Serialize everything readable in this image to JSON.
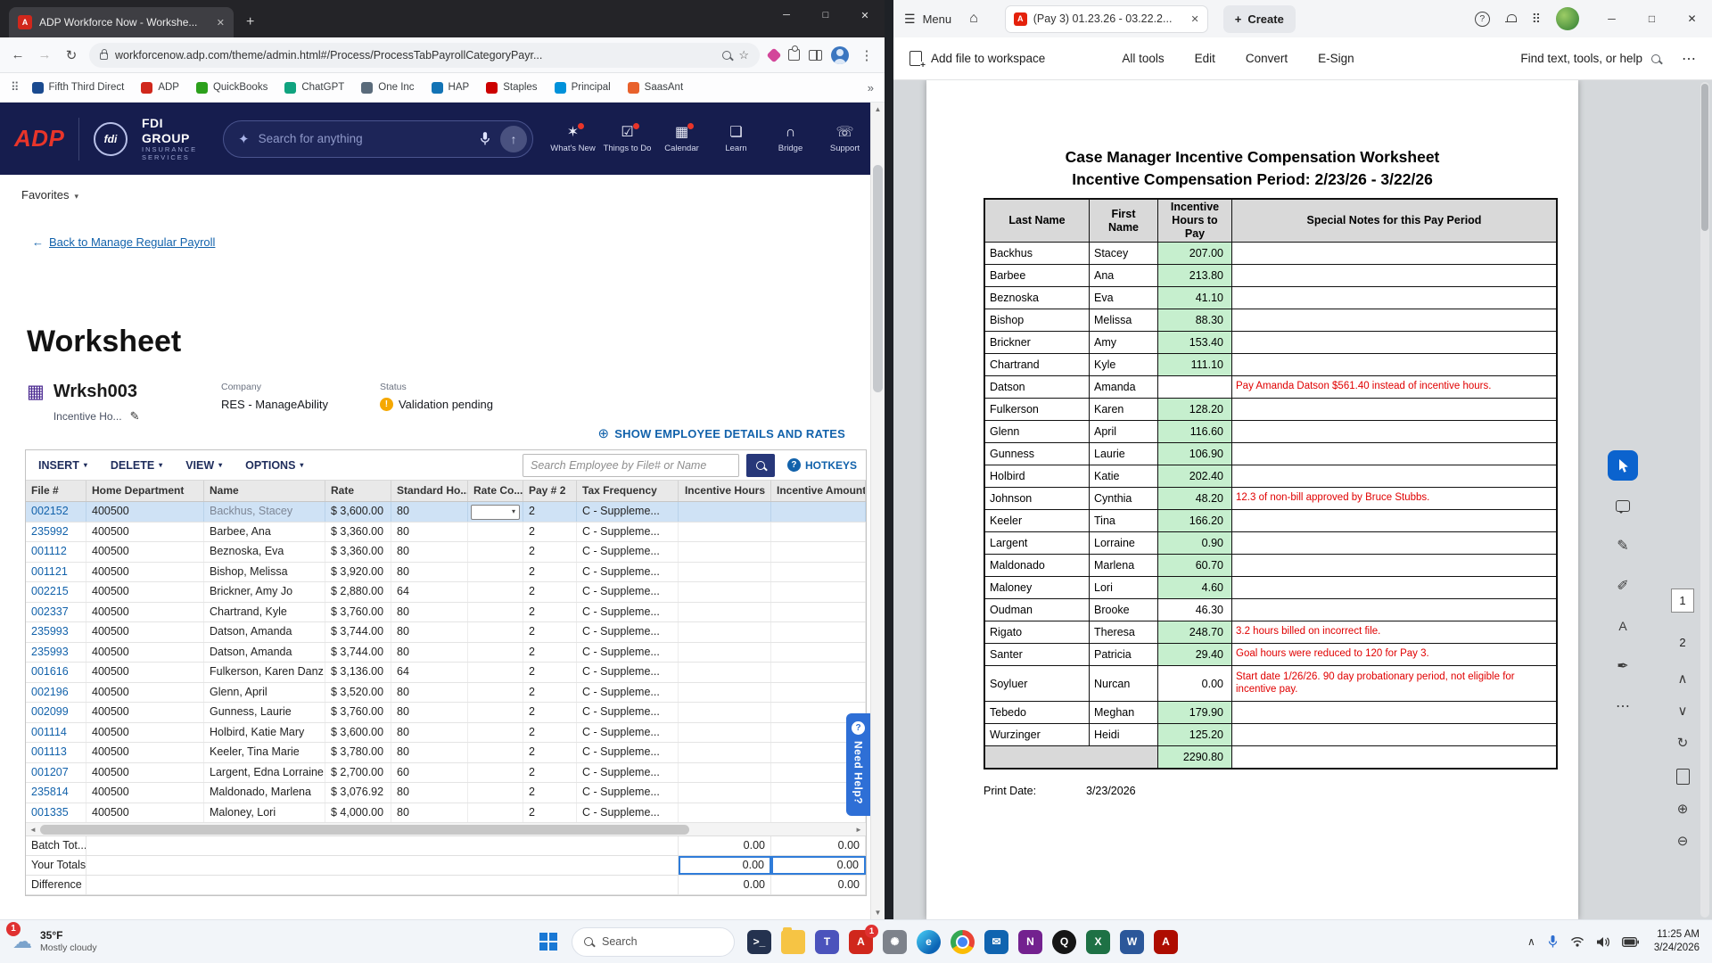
{
  "icons": {
    "close": "✕",
    "minimize": "─",
    "maximize": "□",
    "plus": "+",
    "back": "←",
    "forward": "→",
    "refresh": "↻",
    "star": "☆",
    "ellipsis_v": "⋮",
    "apps_grid": "⠿",
    "overflow": "»",
    "chevron_down": "▾",
    "sparkle": "✦",
    "arrow_up": "↑",
    "plus_circle": "⊕",
    "question": "?",
    "pencil": "✎",
    "warning": "!",
    "grid_icon": "▦",
    "left": "◄",
    "right": "►",
    "up": "▲",
    "down": "▼",
    "hamburger": "☰",
    "home": "⌂",
    "more": "⋯",
    "prev": "∧",
    "next": "∨",
    "rotate": "↻",
    "zoom_in": "⊕",
    "zoom_out": "⊖",
    "chevron_up": "∧",
    "cloud": "☁",
    "highlight": "✐",
    "text_tool": "A",
    "signature": "✒"
  },
  "browser": {
    "favicon_text": "A",
    "tab_title": "ADP Workforce Now - Workshe...",
    "url": "workforcenow.adp.com/theme/admin.html#/Process/ProcessTabPayrollCategoryPayr...",
    "bookmarks": [
      {
        "label": "Fifth Third Direct",
        "color": "#1a4a8f"
      },
      {
        "label": "ADP",
        "color": "#d0271c"
      },
      {
        "label": "QuickBooks",
        "color": "#2ca01c"
      },
      {
        "label": "ChatGPT",
        "color": "#10a37f"
      },
      {
        "label": "One Inc",
        "color": "#5a6b7b"
      },
      {
        "label": "HAP",
        "color": "#1273b5"
      },
      {
        "label": "Staples",
        "color": "#cc0000"
      },
      {
        "label": "Principal",
        "color": "#0091da"
      },
      {
        "label": "SaasAnt",
        "color": "#e8612c"
      }
    ]
  },
  "adp": {
    "logo_text": "ADP",
    "fdi_monogram": "fdi",
    "brand_name": "FDI GROUP",
    "brand_sub": "INSURANCE SERVICES",
    "search_placeholder": "Search for anything",
    "nav_items": [
      {
        "label": "What's New",
        "glyph": "✶",
        "dot": true
      },
      {
        "label": "Things to Do",
        "glyph": "☑",
        "dot": true
      },
      {
        "label": "Calendar",
        "glyph": "▦",
        "dot": true
      },
      {
        "label": "Learn",
        "glyph": "❏"
      },
      {
        "label": "Bridge",
        "glyph": "∩"
      },
      {
        "label": "Support",
        "glyph": "☏"
      }
    ],
    "favorites_label": "Favorites",
    "back_link_label": "Back to Manage Regular Payroll",
    "page_title": "Worksheet",
    "worksheet_code": "Wrksh003",
    "worksheet_subtitle": "Incentive Ho...",
    "company_label": "Company",
    "company_value": "RES - ManageAbility",
    "status_label": "Status",
    "status_value": "Validation pending",
    "show_details_label": "SHOW EMPLOYEE DETAILS AND RATES",
    "menu_buttons": [
      "INSERT",
      "DELETE",
      "VIEW",
      "OPTIONS"
    ],
    "employee_search_placeholder": "Search Employee by File# or Name",
    "hotkeys_label": "HOTKEYS",
    "grid_columns": [
      "File #",
      "Home Department",
      "Name",
      "Rate",
      "Standard Ho...",
      "Rate Co...",
      "Pay # 2",
      "Tax Frequency",
      "Incentive Hours",
      "Incentive Amount"
    ],
    "grid_rows": [
      {
        "file": "002152",
        "dept": "400500",
        "name": "Backhus, Stacey",
        "rate": "$ 3,600.00",
        "std": "80",
        "pay2": "2",
        "tax": "C - Suppleme...",
        "selected": true,
        "dropdown": true
      },
      {
        "file": "235992",
        "dept": "400500",
        "name": "Barbee, Ana",
        "rate": "$ 3,360.00",
        "std": "80",
        "pay2": "2",
        "tax": "C - Suppleme..."
      },
      {
        "file": "001112",
        "dept": "400500",
        "name": "Beznoska, Eva",
        "rate": "$ 3,360.00",
        "std": "80",
        "pay2": "2",
        "tax": "C - Suppleme..."
      },
      {
        "file": "001121",
        "dept": "400500",
        "name": "Bishop, Melissa",
        "rate": "$ 3,920.00",
        "std": "80",
        "pay2": "2",
        "tax": "C - Suppleme..."
      },
      {
        "file": "002215",
        "dept": "400500",
        "name": "Brickner, Amy Jo",
        "rate": "$ 2,880.00",
        "std": "64",
        "pay2": "2",
        "tax": "C - Suppleme..."
      },
      {
        "file": "002337",
        "dept": "400500",
        "name": "Chartrand, Kyle",
        "rate": "$ 3,760.00",
        "std": "80",
        "pay2": "2",
        "tax": "C - Suppleme..."
      },
      {
        "file": "235993",
        "dept": "400500",
        "name": "Datson, Amanda",
        "rate": "$ 3,744.00",
        "std": "80",
        "pay2": "2",
        "tax": "C - Suppleme..."
      },
      {
        "file": "235993",
        "dept": "400500",
        "name": "Datson, Amanda",
        "rate": "$ 3,744.00",
        "std": "80",
        "pay2": "2",
        "tax": "C - Suppleme..."
      },
      {
        "file": "001616",
        "dept": "400500",
        "name": "Fulkerson, Karen Danz",
        "rate": "$ 3,136.00",
        "std": "64",
        "pay2": "2",
        "tax": "C - Suppleme..."
      },
      {
        "file": "002196",
        "dept": "400500",
        "name": "Glenn, April",
        "rate": "$ 3,520.00",
        "std": "80",
        "pay2": "2",
        "tax": "C - Suppleme..."
      },
      {
        "file": "002099",
        "dept": "400500",
        "name": "Gunness, Laurie",
        "rate": "$ 3,760.00",
        "std": "80",
        "pay2": "2",
        "tax": "C - Suppleme..."
      },
      {
        "file": "001114",
        "dept": "400500",
        "name": "Holbird, Katie Mary",
        "rate": "$ 3,600.00",
        "std": "80",
        "pay2": "2",
        "tax": "C - Suppleme..."
      },
      {
        "file": "001113",
        "dept": "400500",
        "name": "Keeler, Tina Marie",
        "rate": "$ 3,780.00",
        "std": "80",
        "pay2": "2",
        "tax": "C - Suppleme..."
      },
      {
        "file": "001207",
        "dept": "400500",
        "name": "Largent, Edna Lorraine",
        "rate": "$ 2,700.00",
        "std": "60",
        "pay2": "2",
        "tax": "C - Suppleme..."
      },
      {
        "file": "235814",
        "dept": "400500",
        "name": "Maldonado, Marlena",
        "rate": "$ 3,076.92",
        "std": "80",
        "pay2": "2",
        "tax": "C - Suppleme..."
      },
      {
        "file": "001335",
        "dept": "400500",
        "name": "Maloney, Lori",
        "rate": "$ 4,000.00",
        "std": "80",
        "pay2": "2",
        "tax": "C - Suppleme..."
      }
    ],
    "totals_rows": [
      {
        "label": "Batch Tot...",
        "hours": "0.00",
        "amount": "0.00"
      },
      {
        "label": "Your Totals",
        "hours": "0.00",
        "amount": "0.00",
        "outlined": true
      },
      {
        "label": "Difference",
        "hours": "0.00",
        "amount": "0.00"
      }
    ],
    "need_help_label": "Need Help?"
  },
  "acrobat": {
    "menu_label": "Menu",
    "pdf_icon_letter": "A",
    "tab_title": "(Pay 3) 01.23.26 - 03.22.2...",
    "create_label": "Create",
    "add_file_label": "Add file to workspace",
    "toolbar_tabs": [
      "All tools",
      "Edit",
      "Convert",
      "E-Sign"
    ],
    "find_label": "Find text, tools, or help",
    "current_page": "1",
    "page2": "2",
    "pdf": {
      "title_line1": "Case Manager Incentive Compensation Worksheet",
      "title_line2": "Incentive Compensation Period: 2/23/26 - 3/22/26",
      "columns": [
        "Last Name",
        "First Name",
        "Incentive Hours to Pay",
        "Special Notes for this Pay Period"
      ],
      "rows": [
        {
          "last": "Backhus",
          "first": "Stacey",
          "hours": "207.00",
          "green": true,
          "note": ""
        },
        {
          "last": "Barbee",
          "first": "Ana",
          "hours": "213.80",
          "green": true,
          "note": ""
        },
        {
          "last": "Beznoska",
          "first": "Eva",
          "hours": "41.10",
          "green": true,
          "note": ""
        },
        {
          "last": "Bishop",
          "first": "Melissa",
          "hours": "88.30",
          "green": true,
          "note": ""
        },
        {
          "last": "Brickner",
          "first": "Amy",
          "hours": "153.40",
          "green": true,
          "note": ""
        },
        {
          "last": "Chartrand",
          "first": "Kyle",
          "hours": "111.10",
          "green": true,
          "note": ""
        },
        {
          "last": "Datson",
          "first": "Amanda",
          "hours": "",
          "note": "Pay Amanda Datson $561.40 instead of incentive hours."
        },
        {
          "last": "Fulkerson",
          "first": "Karen",
          "hours": "128.20",
          "green": true,
          "note": ""
        },
        {
          "last": "Glenn",
          "first": "April",
          "hours": "116.60",
          "green": true,
          "note": ""
        },
        {
          "last": "Gunness",
          "first": "Laurie",
          "hours": "106.90",
          "green": true,
          "note": ""
        },
        {
          "last": "Holbird",
          "first": "Katie",
          "hours": "202.40",
          "green": true,
          "note": ""
        },
        {
          "last": "Johnson",
          "first": "Cynthia",
          "hours": "48.20",
          "green": true,
          "note": "12.3 of non-bill approved by Bruce Stubbs."
        },
        {
          "last": "Keeler",
          "first": "Tina",
          "hours": "166.20",
          "green": true,
          "note": ""
        },
        {
          "last": "Largent",
          "first": "Lorraine",
          "hours": "0.90",
          "green": true,
          "note": ""
        },
        {
          "last": "Maldonado",
          "first": "Marlena",
          "hours": "60.70",
          "green": true,
          "note": ""
        },
        {
          "last": "Maloney",
          "first": "Lori",
          "hours": "4.60",
          "green": true,
          "note": ""
        },
        {
          "last": "Oudman",
          "first": "Brooke",
          "hours": "46.30",
          "note": ""
        },
        {
          "last": "Rigato",
          "first": "Theresa",
          "hours": "248.70",
          "green": true,
          "note": "3.2 hours billed on incorrect file."
        },
        {
          "last": "Santer",
          "first": "Patricia",
          "hours": "29.40",
          "green": true,
          "note": "Goal hours were reduced to 120 for Pay 3."
        },
        {
          "last": "Soyluer",
          "first": "Nurcan",
          "hours": "0.00",
          "tall": true,
          "note": "Start date 1/26/26. 90 day probationary period, not eligible for incentive pay."
        },
        {
          "last": "Tebedo",
          "first": "Meghan",
          "hours": "179.90",
          "green": true,
          "note": ""
        },
        {
          "last": "Wurzinger",
          "first": "Heidi",
          "hours": "125.20",
          "green": true,
          "note": ""
        }
      ],
      "total_hours": "2290.80",
      "print_date_label": "Print Date:",
      "print_date_value": "3/23/2026"
    }
  },
  "taskbar": {
    "weather_badge": "1",
    "weather_temp": "35°F",
    "weather_desc": "Mostly cloudy",
    "search_placeholder": "Search",
    "apps": [
      {
        "name": "terminal",
        "color": "#24324f",
        "glyph": ">_"
      },
      {
        "name": "file-explorer",
        "color": "",
        "glyph": "",
        "folder": true
      },
      {
        "name": "teams",
        "color": "#4b53bc",
        "glyph": "T"
      },
      {
        "name": "adp",
        "color": "#d0271c",
        "glyph": "A",
        "badge": "1"
      },
      {
        "name": "settings",
        "color": "#7d828b",
        "glyph": "✺"
      },
      {
        "name": "edge",
        "color": "",
        "glyph": "e",
        "round": true,
        "edge": true
      },
      {
        "name": "chrome",
        "color": "",
        "glyph": "",
        "round": true,
        "chrome": true
      },
      {
        "name": "outlook",
        "color": "#1064b0",
        "glyph": "✉"
      },
      {
        "name": "onenote",
        "color": "#73218f",
        "glyph": "N"
      },
      {
        "name": "quickbooks",
        "color": "#161616",
        "glyph": "Q",
        "round": true
      },
      {
        "name": "excel",
        "color": "#1e7145",
        "glyph": "X"
      },
      {
        "name": "word",
        "color": "#2b579a",
        "glyph": "W"
      },
      {
        "name": "acrobat",
        "color": "#ae0c00",
        "glyph": "A"
      }
    ],
    "time": "11:25 AM",
    "date": "3/24/2026"
  }
}
